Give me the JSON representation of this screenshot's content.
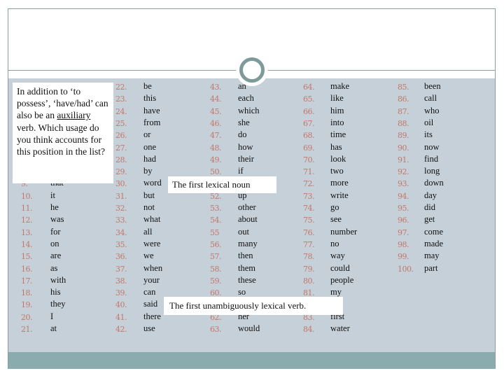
{
  "colors": {
    "background": "#c5d0d8",
    "number": "#c4776a",
    "band": "#8aacae",
    "circle": "#7f9a9a"
  },
  "columns": [
    [
      null,
      null,
      null,
      null,
      null,
      null,
      null,
      null,
      {
        "n": "9.",
        "w": "that"
      },
      {
        "n": "10.",
        "w": "it"
      },
      {
        "n": "11.",
        "w": "he"
      },
      {
        "n": "12.",
        "w": "was"
      },
      {
        "n": "13.",
        "w": "for"
      },
      {
        "n": "14.",
        "w": "on"
      },
      {
        "n": "15.",
        "w": "are"
      },
      {
        "n": "16.",
        "w": "as"
      },
      {
        "n": "17.",
        "w": "with"
      },
      {
        "n": "18.",
        "w": "his"
      },
      {
        "n": "19.",
        "w": "they"
      },
      {
        "n": "20.",
        "w": "I"
      },
      {
        "n": "21.",
        "w": "at"
      }
    ],
    [
      {
        "n": "22.",
        "w": "be"
      },
      {
        "n": "23.",
        "w": "this"
      },
      {
        "n": "24.",
        "w": "have"
      },
      {
        "n": "25.",
        "w": "from"
      },
      {
        "n": "26.",
        "w": "or"
      },
      {
        "n": "27.",
        "w": "one"
      },
      {
        "n": "28.",
        "w": "had"
      },
      {
        "n": "29.",
        "w": "by"
      },
      {
        "n": "30.",
        "w": "word"
      },
      {
        "n": "31.",
        "w": "but"
      },
      {
        "n": "32.",
        "w": "not"
      },
      {
        "n": "33.",
        "w": "what"
      },
      {
        "n": "34.",
        "w": "all"
      },
      {
        "n": "35.",
        "w": "were"
      },
      {
        "n": "36.",
        "w": "we"
      },
      {
        "n": "37.",
        "w": "when"
      },
      {
        "n": "38.",
        "w": "your"
      },
      {
        "n": "39.",
        "w": "can"
      },
      {
        "n": "40.",
        "w": "said"
      },
      {
        "n": "41.",
        "w": "there"
      },
      {
        "n": "42.",
        "w": "use"
      }
    ],
    [
      {
        "n": "43.",
        "w": "an"
      },
      {
        "n": "44.",
        "w": "each"
      },
      {
        "n": "45.",
        "w": "which"
      },
      {
        "n": "46.",
        "w": "she"
      },
      {
        "n": "47.",
        "w": "do"
      },
      {
        "n": "48.",
        "w": "how"
      },
      {
        "n": "49.",
        "w": "their"
      },
      {
        "n": "50.",
        "w": "if"
      },
      null,
      {
        "n": "52.",
        "w": "up"
      },
      {
        "n": "53.",
        "w": "other"
      },
      {
        "n": "54.",
        "w": "about"
      },
      {
        "n": "55",
        "w": "out"
      },
      {
        "n": "56.",
        "w": "many"
      },
      {
        "n": "57.",
        "w": "then"
      },
      {
        "n": "58.",
        "w": "them"
      },
      {
        "n": "59.",
        "w": "these"
      },
      {
        "n": "60.",
        "w": "so"
      },
      null,
      {
        "n": "62.",
        "w": "her"
      },
      {
        "n": "63.",
        "w": "would"
      }
    ],
    [
      {
        "n": "64.",
        "w": "make"
      },
      {
        "n": "65.",
        "w": "like"
      },
      {
        "n": "66.",
        "w": "him"
      },
      {
        "n": "67.",
        "w": "into"
      },
      {
        "n": "68.",
        "w": "time"
      },
      {
        "n": "69.",
        "w": "has"
      },
      {
        "n": "70.",
        "w": "look"
      },
      {
        "n": "71.",
        "w": "two"
      },
      {
        "n": "72.",
        "w": "more"
      },
      {
        "n": "73.",
        "w": "write"
      },
      {
        "n": "74.",
        "w": "go"
      },
      {
        "n": "75.",
        "w": "see"
      },
      {
        "n": "76.",
        "w": "number"
      },
      {
        "n": "77.",
        "w": "no"
      },
      {
        "n": "78.",
        "w": "way"
      },
      {
        "n": "79.",
        "w": "could"
      },
      {
        "n": "80.",
        "w": "people"
      },
      {
        "n": "81.",
        "w": "my"
      },
      null,
      {
        "n": "83.",
        "w": "first"
      },
      {
        "n": "84.",
        "w": "water"
      }
    ],
    [
      {
        "n": "85.",
        "w": "been"
      },
      {
        "n": "86.",
        "w": "call"
      },
      {
        "n": "87.",
        "w": "who"
      },
      {
        "n": "88.",
        "w": "oil"
      },
      {
        "n": "89.",
        "w": "its"
      },
      {
        "n": "90.",
        "w": "now"
      },
      {
        "n": "91.",
        "w": "find"
      },
      {
        "n": "92.",
        "w": "long"
      },
      {
        "n": "93.",
        "w": "down"
      },
      {
        "n": "94.",
        "w": "day"
      },
      {
        "n": "95.",
        "w": "did"
      },
      {
        "n": "96.",
        "w": "get"
      },
      {
        "n": "97.",
        "w": "come"
      },
      {
        "n": "98.",
        "w": "made"
      },
      {
        "n": "99.",
        "w": "may"
      },
      {
        "n": "100.",
        "w": "part"
      }
    ]
  ],
  "callouts": {
    "auxiliary": {
      "before": "In addition to ‘to possess’, ‘have/had’ can also be an ",
      "underlined": "auxiliary",
      "after": " verb. Which usage do you think accounts for this position in the list?"
    },
    "noun": "The first lexical noun",
    "verb": "The first unambiguously lexical verb."
  }
}
